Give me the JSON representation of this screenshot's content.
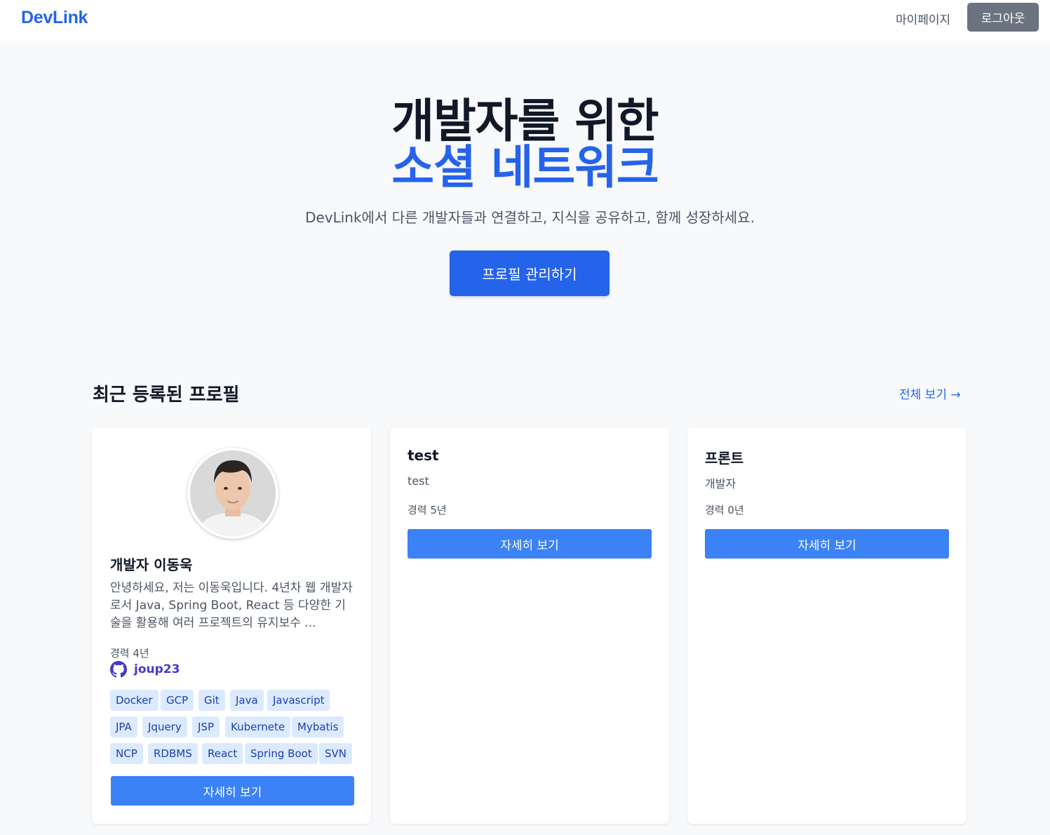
{
  "nav": {
    "logo": "DevLink",
    "mypage": "마이페이지",
    "logout": "로그아웃"
  },
  "hero": {
    "title_line1": "개발자를 위한",
    "title_line2": "소셜 네트워크",
    "subtitle": "DevLink에서 다른 개발자들과 연결하고, 지식을 공유하고, 함께 성장하세요.",
    "cta": "프로필 관리하기"
  },
  "section": {
    "title": "최근 등록된 프로필",
    "view_all": "전체 보기 →"
  },
  "profiles": [
    {
      "name": "개발자 이동욱",
      "bio": "안녕하세요, 저는 이동욱입니다. 4년차 웹 개발자로서 Java, Spring Boot, React 등 다양한 기술을 활용해 여러 프로젝트의 유지보수 ...",
      "experience": "경력 4년",
      "github": "joup23",
      "skills": [
        "Docker",
        "GCP",
        "Git",
        "Java",
        "Javascript",
        "JPA",
        "Jquery",
        "JSP",
        "Kubernete",
        "Mybatis",
        "NCP",
        "RDBMS",
        "React",
        "Spring Boot",
        "SVN"
      ],
      "detail": "자세히 보기"
    },
    {
      "name": "test",
      "role": "test",
      "experience": "경력 5년",
      "detail": "자세히 보기"
    },
    {
      "name": "프론트",
      "role": "개발자",
      "experience": "경력 0년",
      "detail": "자세히 보기"
    }
  ],
  "colors": {
    "primary": "#2563eb",
    "button": "#3b82f6",
    "tag_bg": "#dbeafe",
    "tag_text": "#1e40af",
    "logout_bg": "#6b7280"
  }
}
